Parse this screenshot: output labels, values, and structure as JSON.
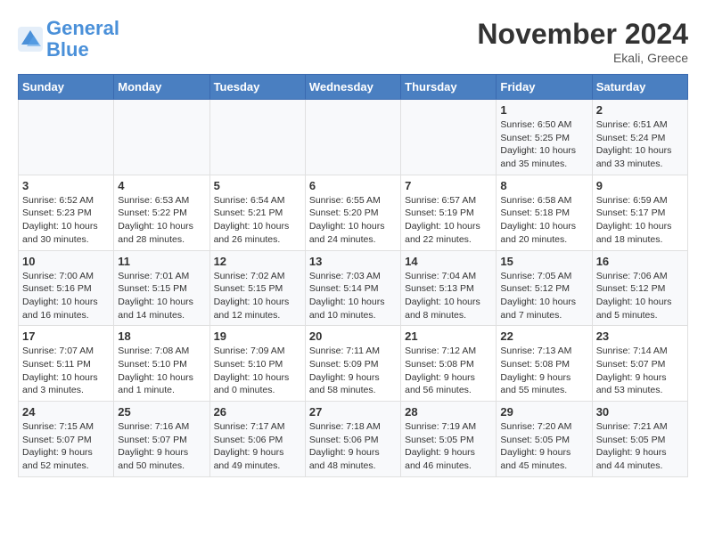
{
  "header": {
    "logo_line1": "General",
    "logo_line2": "Blue",
    "month": "November 2024",
    "location": "Ekali, Greece"
  },
  "weekdays": [
    "Sunday",
    "Monday",
    "Tuesday",
    "Wednesday",
    "Thursday",
    "Friday",
    "Saturday"
  ],
  "rows": [
    [
      {
        "day": "",
        "info": ""
      },
      {
        "day": "",
        "info": ""
      },
      {
        "day": "",
        "info": ""
      },
      {
        "day": "",
        "info": ""
      },
      {
        "day": "",
        "info": ""
      },
      {
        "day": "1",
        "info": "Sunrise: 6:50 AM\nSunset: 5:25 PM\nDaylight: 10 hours and 35 minutes."
      },
      {
        "day": "2",
        "info": "Sunrise: 6:51 AM\nSunset: 5:24 PM\nDaylight: 10 hours and 33 minutes."
      }
    ],
    [
      {
        "day": "3",
        "info": "Sunrise: 6:52 AM\nSunset: 5:23 PM\nDaylight: 10 hours and 30 minutes."
      },
      {
        "day": "4",
        "info": "Sunrise: 6:53 AM\nSunset: 5:22 PM\nDaylight: 10 hours and 28 minutes."
      },
      {
        "day": "5",
        "info": "Sunrise: 6:54 AM\nSunset: 5:21 PM\nDaylight: 10 hours and 26 minutes."
      },
      {
        "day": "6",
        "info": "Sunrise: 6:55 AM\nSunset: 5:20 PM\nDaylight: 10 hours and 24 minutes."
      },
      {
        "day": "7",
        "info": "Sunrise: 6:57 AM\nSunset: 5:19 PM\nDaylight: 10 hours and 22 minutes."
      },
      {
        "day": "8",
        "info": "Sunrise: 6:58 AM\nSunset: 5:18 PM\nDaylight: 10 hours and 20 minutes."
      },
      {
        "day": "9",
        "info": "Sunrise: 6:59 AM\nSunset: 5:17 PM\nDaylight: 10 hours and 18 minutes."
      }
    ],
    [
      {
        "day": "10",
        "info": "Sunrise: 7:00 AM\nSunset: 5:16 PM\nDaylight: 10 hours and 16 minutes."
      },
      {
        "day": "11",
        "info": "Sunrise: 7:01 AM\nSunset: 5:15 PM\nDaylight: 10 hours and 14 minutes."
      },
      {
        "day": "12",
        "info": "Sunrise: 7:02 AM\nSunset: 5:15 PM\nDaylight: 10 hours and 12 minutes."
      },
      {
        "day": "13",
        "info": "Sunrise: 7:03 AM\nSunset: 5:14 PM\nDaylight: 10 hours and 10 minutes."
      },
      {
        "day": "14",
        "info": "Sunrise: 7:04 AM\nSunset: 5:13 PM\nDaylight: 10 hours and 8 minutes."
      },
      {
        "day": "15",
        "info": "Sunrise: 7:05 AM\nSunset: 5:12 PM\nDaylight: 10 hours and 7 minutes."
      },
      {
        "day": "16",
        "info": "Sunrise: 7:06 AM\nSunset: 5:12 PM\nDaylight: 10 hours and 5 minutes."
      }
    ],
    [
      {
        "day": "17",
        "info": "Sunrise: 7:07 AM\nSunset: 5:11 PM\nDaylight: 10 hours and 3 minutes."
      },
      {
        "day": "18",
        "info": "Sunrise: 7:08 AM\nSunset: 5:10 PM\nDaylight: 10 hours and 1 minute."
      },
      {
        "day": "19",
        "info": "Sunrise: 7:09 AM\nSunset: 5:10 PM\nDaylight: 10 hours and 0 minutes."
      },
      {
        "day": "20",
        "info": "Sunrise: 7:11 AM\nSunset: 5:09 PM\nDaylight: 9 hours and 58 minutes."
      },
      {
        "day": "21",
        "info": "Sunrise: 7:12 AM\nSunset: 5:08 PM\nDaylight: 9 hours and 56 minutes."
      },
      {
        "day": "22",
        "info": "Sunrise: 7:13 AM\nSunset: 5:08 PM\nDaylight: 9 hours and 55 minutes."
      },
      {
        "day": "23",
        "info": "Sunrise: 7:14 AM\nSunset: 5:07 PM\nDaylight: 9 hours and 53 minutes."
      }
    ],
    [
      {
        "day": "24",
        "info": "Sunrise: 7:15 AM\nSunset: 5:07 PM\nDaylight: 9 hours and 52 minutes."
      },
      {
        "day": "25",
        "info": "Sunrise: 7:16 AM\nSunset: 5:07 PM\nDaylight: 9 hours and 50 minutes."
      },
      {
        "day": "26",
        "info": "Sunrise: 7:17 AM\nSunset: 5:06 PM\nDaylight: 9 hours and 49 minutes."
      },
      {
        "day": "27",
        "info": "Sunrise: 7:18 AM\nSunset: 5:06 PM\nDaylight: 9 hours and 48 minutes."
      },
      {
        "day": "28",
        "info": "Sunrise: 7:19 AM\nSunset: 5:05 PM\nDaylight: 9 hours and 46 minutes."
      },
      {
        "day": "29",
        "info": "Sunrise: 7:20 AM\nSunset: 5:05 PM\nDaylight: 9 hours and 45 minutes."
      },
      {
        "day": "30",
        "info": "Sunrise: 7:21 AM\nSunset: 5:05 PM\nDaylight: 9 hours and 44 minutes."
      }
    ]
  ]
}
